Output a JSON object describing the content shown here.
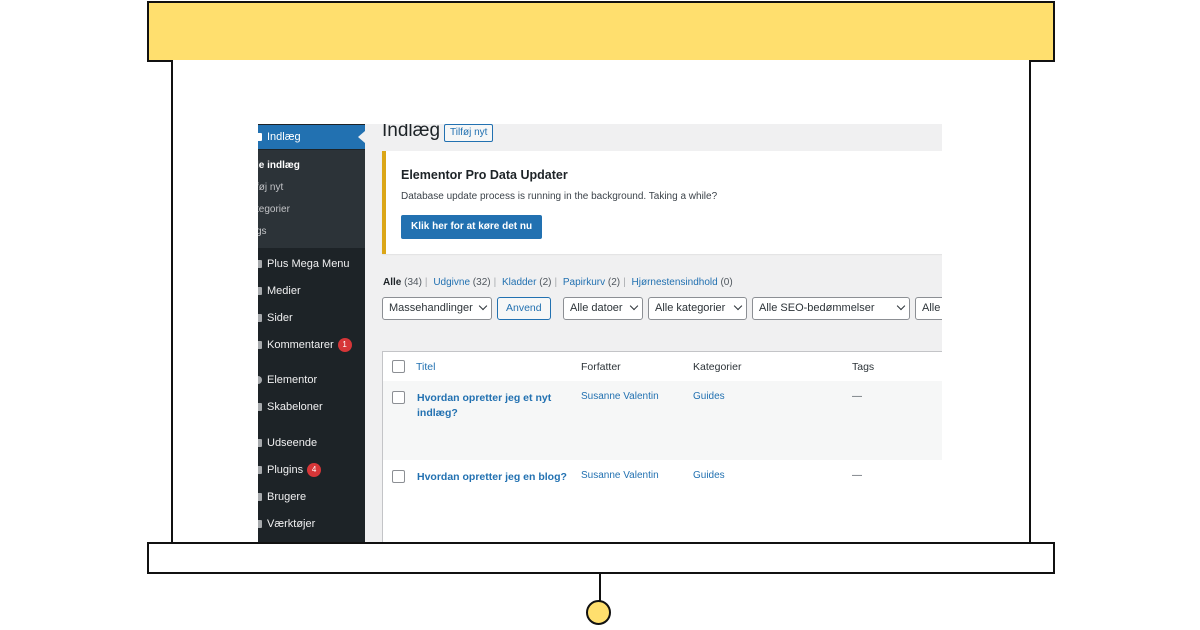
{
  "colors": {
    "frame_accent": "#ffdf6e",
    "frame_outline": "#111111",
    "sidebar_bg": "#1d2327",
    "sidebar_active": "#2271b1",
    "link": "#2271b1",
    "notice_border": "#dba617",
    "badge": "#d63638"
  },
  "sidebar": {
    "active_item": "Indlæg",
    "submenu": [
      "le indlæg",
      "føj nyt",
      "tegorier",
      "gs"
    ],
    "items": [
      {
        "label": "Plus Mega Menu",
        "icon": "menu-icon"
      },
      {
        "label": "Medier",
        "icon": "media-icon"
      },
      {
        "label": "Sider",
        "icon": "pages-icon"
      },
      {
        "label": "Kommentarer",
        "icon": "comments-icon",
        "badge": "1"
      },
      {
        "label": "Elementor",
        "icon": "elementor-icon"
      },
      {
        "label": "Skabeloner",
        "icon": "templates-icon"
      },
      {
        "label": "Udseende",
        "icon": "appearance-icon"
      },
      {
        "label": "Plugins",
        "icon": "plugins-icon",
        "badge": "4"
      },
      {
        "label": "Brugere",
        "icon": "users-icon"
      },
      {
        "label": "Værktøjer",
        "icon": "tools-icon"
      }
    ]
  },
  "header": {
    "title": "Indlæg",
    "add_new": "Tilføj nyt"
  },
  "notice": {
    "title": "Elementor Pro Data Updater",
    "text": "Database update process is running in the background. Taking a while?",
    "button": "Klik her for at køre det nu"
  },
  "filters": {
    "all": {
      "label": "Alle",
      "count": "(34)"
    },
    "published": {
      "label": "Udgivne",
      "count": "(32)"
    },
    "drafts": {
      "label": "Kladder",
      "count": "(2)"
    },
    "trash": {
      "label": "Papirkurv",
      "count": "(2)"
    },
    "cornerstone": {
      "label": "Hjørnestensindhold",
      "count": "(0)"
    }
  },
  "toolbar": {
    "bulk_actions": "Massehandlinger",
    "apply": "Anvend",
    "dates": "Alle datoer",
    "categories": "Alle kategorier",
    "seo": "Alle SEO-bedømmelser",
    "more": "Alle"
  },
  "table": {
    "columns": [
      "Titel",
      "Forfatter",
      "Kategorier",
      "Tags"
    ],
    "rows": [
      {
        "title": "Hvordan opretter jeg et nyt indlæg?",
        "author": "Susanne Valentin",
        "category": "Guides",
        "tags": "—"
      },
      {
        "title": "Hvordan opretter jeg en blog?",
        "author": "Susanne Valentin",
        "category": "Guides",
        "tags": "—"
      }
    ]
  }
}
